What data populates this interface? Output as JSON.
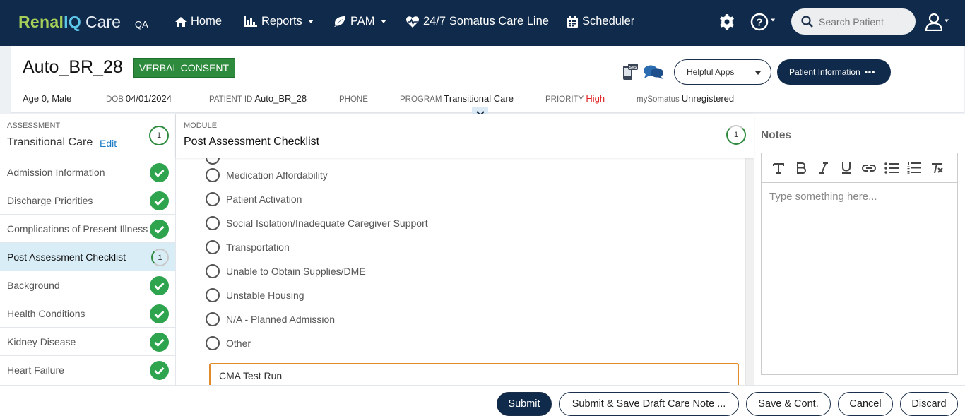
{
  "nav": {
    "brand_renal": "Renal",
    "brand_iq": "IQ",
    "brand_care": "Care",
    "env": "- QA",
    "home": "Home",
    "reports": "Reports",
    "pam": "PAM",
    "careline": "24/7 Somatus Care Line",
    "scheduler": "Scheduler",
    "search_placeholder": "Search Patient"
  },
  "patient": {
    "name": "Auto_BR_28",
    "consent": "VERBAL CONSENT",
    "age_sex": "Age 0, Male",
    "dob_label": "DOB",
    "dob": "04/01/2024",
    "id_label": "PATIENT ID",
    "id": "Auto_BR_28",
    "phone_label": "PHONE",
    "phone": "",
    "program_label": "PROGRAM",
    "program": "Transitional Care",
    "priority_label": "PRIORITY",
    "priority": "High",
    "mysomatus_label": "mySomatus",
    "mysomatus": "Unregistered",
    "helpful_apps": "Helpful Apps",
    "patient_info": "Patient Information",
    "dots": "•••"
  },
  "sidebar": {
    "label": "ASSESSMENT",
    "title": "Transitional Care",
    "edit": "Edit",
    "count": "1",
    "items": [
      {
        "label": "Admission Information",
        "status": "done"
      },
      {
        "label": "Discharge Priorities",
        "status": "done"
      },
      {
        "label": "Complications of Present Illness",
        "status": "done"
      },
      {
        "label": "Post Assessment Checklist",
        "status": "partial",
        "count": "1"
      },
      {
        "label": "Background",
        "status": "done"
      },
      {
        "label": "Health Conditions",
        "status": "done"
      },
      {
        "label": "Kidney Disease",
        "status": "done"
      },
      {
        "label": "Heart Failure",
        "status": "done"
      }
    ]
  },
  "module": {
    "label": "MODULE",
    "title": "Post Assessment Checklist",
    "count": "1",
    "options": [
      "Medication Affordability",
      "Patient Activation",
      "Social Isolation/Inadequate Caregiver Support",
      "Transportation",
      "Unable to Obtain Supplies/DME",
      "Unstable Housing",
      "N/A - Planned Admission",
      "Other"
    ],
    "other_value": "CMA Test Run"
  },
  "notes": {
    "title": "Notes",
    "placeholder": "Type something here..."
  },
  "footer": {
    "submit": "Submit",
    "submit_draft": "Submit & Save Draft Care Note ...",
    "save_cont": "Save & Cont.",
    "cancel": "Cancel",
    "discard": "Discard"
  },
  "colors": {
    "navy": "#0f2a4a",
    "green": "#2fa44f",
    "consent_green": "#2e8b3e",
    "priority_red": "#e02020",
    "accent_orange": "#e08a2a"
  }
}
